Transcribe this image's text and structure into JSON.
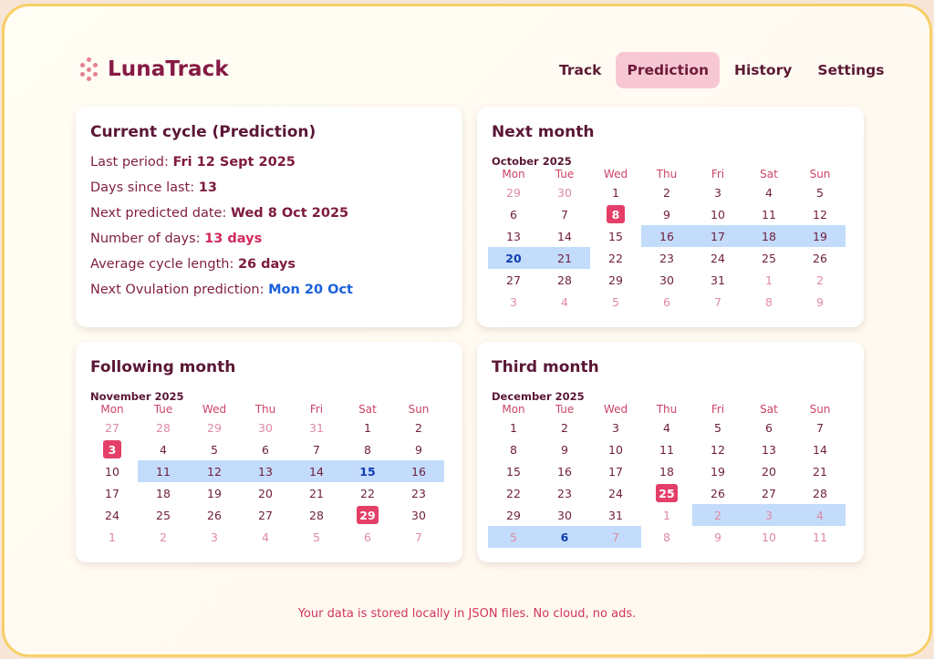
{
  "app": {
    "name": "LunaTrack",
    "logo_icon": "dots-logo-icon"
  },
  "nav": {
    "items": [
      {
        "label": "Track",
        "active": false
      },
      {
        "label": "Prediction",
        "active": true
      },
      {
        "label": "History",
        "active": false
      },
      {
        "label": "Settings",
        "active": false
      }
    ]
  },
  "summary": {
    "title": "Current cycle (Prediction)",
    "rows": [
      {
        "label": "Last period:",
        "value": "Fri 12 Sept 2025",
        "style": "plain"
      },
      {
        "label": "Days since last:",
        "value": "13",
        "style": "plain"
      },
      {
        "label": "Next predicted date:",
        "value": "Wed 8 Oct 2025",
        "style": "plain"
      },
      {
        "label": "Number of days:",
        "value": "13 days",
        "style": "red"
      },
      {
        "label": "Average cycle length:",
        "value": "26 days",
        "style": "plain"
      },
      {
        "label": "Next Ovulation prediction:",
        "value": "Mon 20 Oct",
        "style": "blue"
      }
    ]
  },
  "weekdays": [
    "Mon",
    "Tue",
    "Wed",
    "Thu",
    "Fri",
    "Sat",
    "Sun"
  ],
  "colors": {
    "period": "#e43f68",
    "fertile": "#c3dcfb",
    "ovulation": "#113db0",
    "accent": "#861a44"
  },
  "calendars": [
    {
      "card_title": "Next month",
      "month_label": "October 2025",
      "first_weekday": 2,
      "days_in_month": 31,
      "prev_month_days": 30,
      "period_days": [
        8
      ],
      "fertile_days": [
        16,
        17,
        18,
        19,
        20,
        21
      ],
      "ovulation_days": [
        20
      ],
      "next_fertile_days": [],
      "next_ovulation_days": []
    },
    {
      "card_title": "Following month",
      "month_label": "November 2025",
      "first_weekday": 5,
      "days_in_month": 30,
      "prev_month_days": 31,
      "period_days": [
        3,
        29
      ],
      "fertile_days": [
        11,
        12,
        13,
        14,
        15,
        16
      ],
      "ovulation_days": [
        15
      ],
      "next_fertile_days": [],
      "next_ovulation_days": []
    },
    {
      "card_title": "Third month",
      "month_label": "December 2025",
      "first_weekday": 0,
      "days_in_month": 31,
      "prev_month_days": 30,
      "period_days": [
        25
      ],
      "fertile_days": [],
      "ovulation_days": [],
      "next_fertile_days": [
        2,
        3,
        4,
        5,
        6,
        7
      ],
      "next_ovulation_days": [
        6
      ]
    }
  ],
  "footer": "Your data is stored locally in JSON files. No cloud, no ads."
}
